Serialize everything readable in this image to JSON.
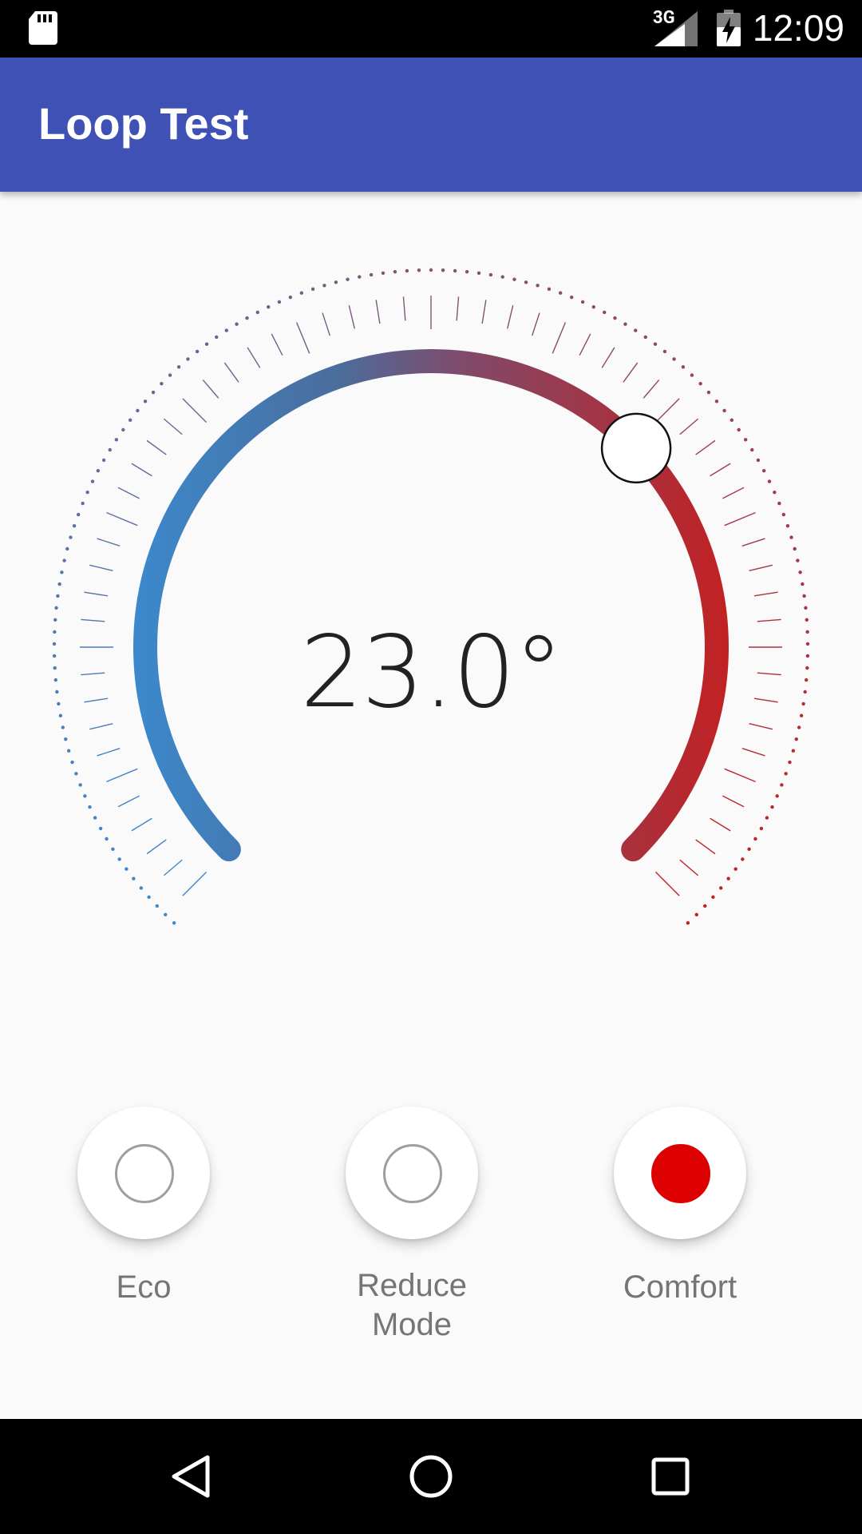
{
  "status_bar": {
    "time": "12:09",
    "network": "3G",
    "icons": [
      "sd-card-icon",
      "signal-icon",
      "battery-charging-icon"
    ]
  },
  "app_bar": {
    "title": "Loop Test"
  },
  "thermostat": {
    "temperature_display": "23.0°",
    "value": 23.0,
    "level_fraction": 0.67,
    "gradient_start_color": "#3a8bd0",
    "gradient_end_color": "#c51f1f"
  },
  "modes": [
    {
      "label": "Eco",
      "selected": false
    },
    {
      "label": "Reduce Mode",
      "selected": false
    },
    {
      "label": "Comfort",
      "selected": true
    }
  ],
  "nav_bar": {
    "icons": [
      "back-icon",
      "home-icon",
      "recents-icon"
    ]
  }
}
